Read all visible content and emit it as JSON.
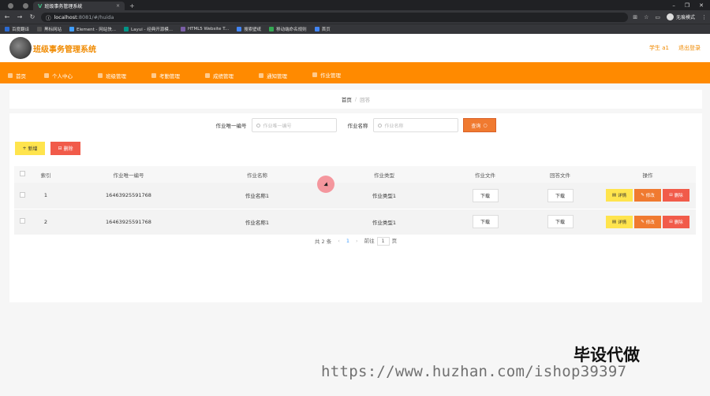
{
  "browser": {
    "tabs": [
      {
        "label": "班级事务管理系统",
        "active": true
      }
    ],
    "url_host": "localhost",
    "url_rest": ":8081/#/huida",
    "incognito_label": "无痕模式",
    "bookmarks": [
      {
        "label": "百度翻译",
        "color": "#2b6bd3"
      },
      {
        "label": "黑标网站",
        "color": "#555555"
      },
      {
        "label": "Element - 网站快...",
        "color": "#409eff"
      },
      {
        "label": "Layui - 经典开源模...",
        "color": "#009688"
      },
      {
        "label": "HTML5 Website T...",
        "color": "#7b5ea7"
      },
      {
        "label": "搜索壁纸",
        "color": "#4285f4"
      },
      {
        "label": "移动端命名规则",
        "color": "#34a853"
      },
      {
        "label": "首页",
        "color": "#4285f4"
      }
    ]
  },
  "app": {
    "title": "班级事务管理系统",
    "user": "学生 a1",
    "logout": "退出登录"
  },
  "menu": [
    {
      "label": "首页",
      "active": false
    },
    {
      "label": "个人中心",
      "active": false
    },
    {
      "label": "班级管理",
      "active": false
    },
    {
      "label": "考勤管理",
      "active": false
    },
    {
      "label": "成绩管理",
      "active": false
    },
    {
      "label": "通知管理",
      "active": false
    },
    {
      "label": "作业管理",
      "active": true
    }
  ],
  "breadcrumb": {
    "home": "首页",
    "sep": "/",
    "current": "回答"
  },
  "search": {
    "label1": "作业唯一编号",
    "placeholder1": "作业唯一编号",
    "label2": "作业名称",
    "placeholder2": "作业名称",
    "button": "查询"
  },
  "actions": {
    "add": "新增",
    "delete": "删除"
  },
  "table": {
    "headers": [
      "索引",
      "作业唯一编号",
      "作业名称",
      "作业类型",
      "作业文件",
      "回答文件",
      "操作"
    ],
    "rows": [
      {
        "index": "1",
        "code": "16463925591768",
        "name": "作业名称1",
        "type": "作业类型1",
        "file_btn": "下载",
        "answer_btn": "下载"
      },
      {
        "index": "2",
        "code": "16463925591768",
        "name": "作业名称1",
        "type": "作业类型1",
        "file_btn": "下载",
        "answer_btn": "下载"
      }
    ],
    "ops": {
      "detail": "详情",
      "edit": "修改",
      "remove": "删除"
    }
  },
  "pager": {
    "total": "共 2 条",
    "page": "1",
    "goto": "前往",
    "jump": "1",
    "unit": "页"
  },
  "watermark": {
    "brand": "毕设代做",
    "url": "https://www.huzhan.com/ishop39397"
  },
  "colors": {
    "accent": "#ff8a00",
    "danger": "#f15b4a",
    "warning": "#ffe44d"
  }
}
